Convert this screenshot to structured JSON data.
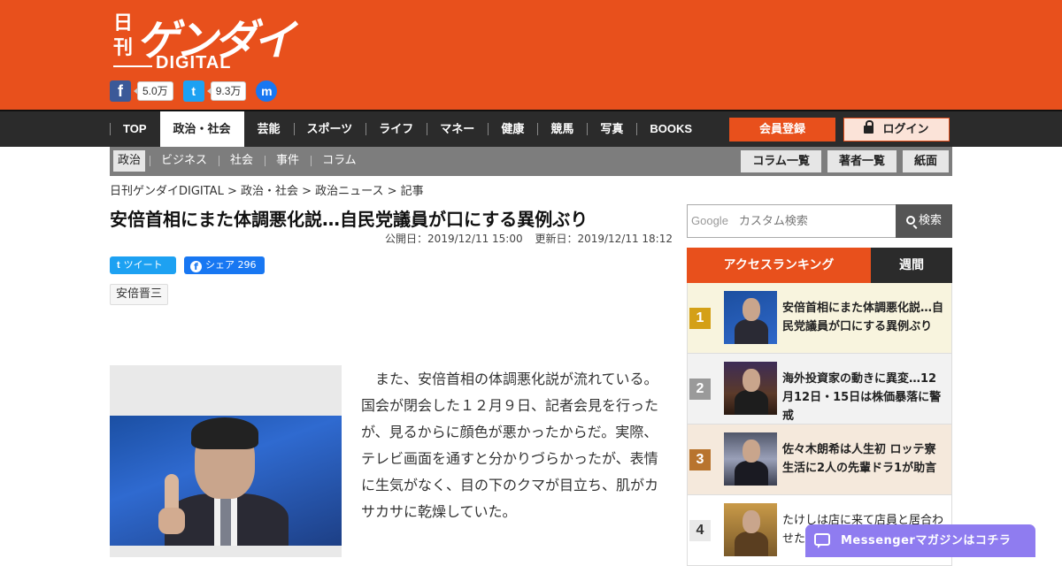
{
  "brand": {
    "logo_nikkan": "日刊",
    "logo_main": "ゲンダイ",
    "logo_digital": "DIGITAL",
    "accent_color": "#e8501c"
  },
  "social": {
    "facebook_icon": "f",
    "facebook_count": "5.0万",
    "twitter_icon": "t",
    "twitter_count": "9.3万",
    "messenger_icon": "m"
  },
  "nav": {
    "items": [
      "TOP",
      "政治・社会",
      "芸能",
      "スポーツ",
      "ライフ",
      "マネー",
      "健康",
      "競馬",
      "写真",
      "BOOKS"
    ],
    "active": "政治・社会",
    "register": "会員登録",
    "login": "ログイン"
  },
  "subnav": {
    "items": [
      "政治",
      "ビジネス",
      "社会",
      "事件",
      "コラム"
    ],
    "active": "政治",
    "buttons": [
      "コラム一覧",
      "著者一覧",
      "紙面"
    ]
  },
  "breadcrumb": "日刊ゲンダイDIGITAL > 政治・社会 > 政治ニュース > 記事",
  "article": {
    "title": "安倍首相にまた体調悪化説…自民党議員が口にする異例ぶり",
    "published": "公開日：2019/12/11 15:00",
    "updated": "更新日：2019/12/11 18:12",
    "tweet_label": "ツイート",
    "share_label": "シェア 296",
    "tag": "安倍晋三",
    "body": "　また、安倍首相の体調悪化説が流れている。国会が閉会した１２月９日、記者会見を行ったが、見るからに顔色が悪かったからだ。実際、テレビ画面を通すと分かりづらかったが、表情に生気がなく、目の下のクマが目立ち、肌がカサカサに乾燥していた。"
  },
  "search": {
    "google_label": "Google",
    "placeholder": "カスタム検索",
    "button": "検索"
  },
  "ranking": {
    "tab_access": "アクセスランキング",
    "tab_week": "週間",
    "items": [
      {
        "rank": "1",
        "title": "安倍首相にまた体調悪化説…自民党議員が口にする異例ぶり",
        "num_color": "#d4a017",
        "bg": "#f8f4de"
      },
      {
        "rank": "2",
        "title": "海外投資家の動きに異変…12月12日・15日は株価暴落に警戒",
        "num_color": "#9a9a9a",
        "bg": "#f2f2f2"
      },
      {
        "rank": "3",
        "title": "佐々木朗希は人生初 ロッテ寮生活に2人の先輩ドラ1が助言",
        "num_color": "#b8742e",
        "bg": "#f5e9dc"
      },
      {
        "rank": "4",
        "title": "たけしは店に来て店員と居合わせた客",
        "num_color": "#444444",
        "bg": "#ffffff"
      }
    ]
  },
  "messenger_bar": "Messengerマガジンはコチラ"
}
